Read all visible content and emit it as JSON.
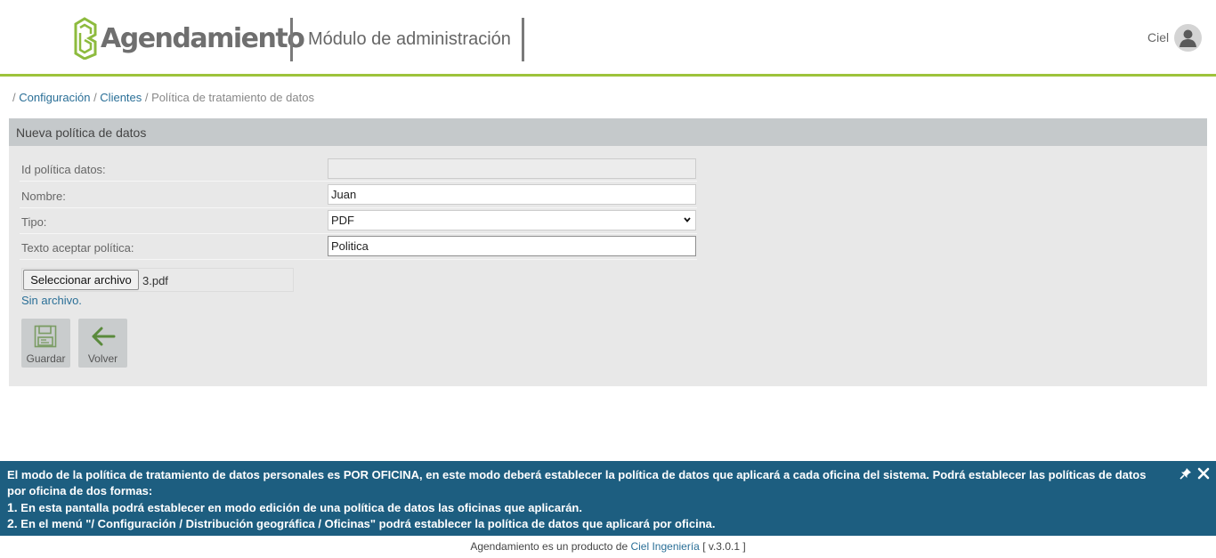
{
  "header": {
    "brand": "Agendamiento",
    "module_title": "Módulo de administración",
    "user_name": "Ciel",
    "accent_color": "#9dc33b"
  },
  "breadcrumb": {
    "sep1": "/ ",
    "item1": "Configuración",
    "sep2": " / ",
    "item2": "Clientes",
    "sep3": " / ",
    "current": "Política de tratamiento de datos"
  },
  "panel": {
    "title": "Nueva política de datos",
    "fields": {
      "id_label": "Id política datos:",
      "id_value": "",
      "name_label": "Nombre:",
      "name_value": "Juan",
      "type_label": "Tipo:",
      "type_value": "PDF",
      "accept_label": "Texto aceptar política:",
      "accept_value": "Politica"
    },
    "file": {
      "button_label": "Seleccionar archivo",
      "file_name": "3.pdf",
      "no_file_text": "Sin archivo."
    },
    "actions": {
      "save_label": "Guardar",
      "back_label": "Volver"
    }
  },
  "info_bar": {
    "main_text": "El modo de la política de tratamiento de datos personales es POR OFICINA, en este modo deberá establecer la política de datos que aplicará a cada oficina del sistema. Podrá establecer las políticas de datos por oficina de dos formas:",
    "item1_num": "1.",
    "item1_text": " En esta pantalla podrá establecer en modo edición de una política de datos las oficinas que aplicarán.",
    "item2_num": "2.",
    "item2_text": " En el menú \"/ Configuración / Distribución geográfica / Oficinas\" podrá establecer la política de datos que aplicará por oficina.",
    "background_color": "#1d5e80"
  },
  "footer": {
    "text_before": "Agendamiento es un producto de ",
    "company": "Ciel Ingeniería",
    "version": " [ v.3.0.1 ]"
  }
}
